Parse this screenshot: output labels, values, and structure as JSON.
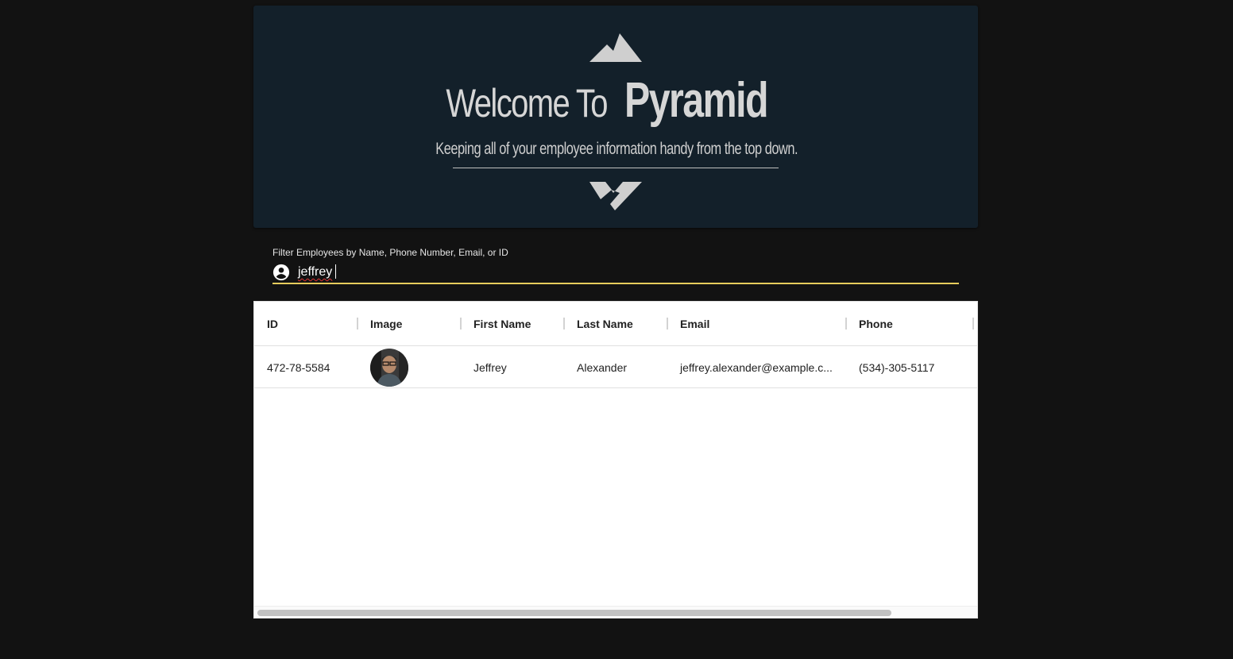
{
  "hero": {
    "welcome": "Welcome To",
    "brand": "Pyramid",
    "subtitle": "Keeping all of your employee information handy from the top down."
  },
  "filter": {
    "label": "Filter Employees by Name, Phone Number, Email, or ID",
    "value": "jeffrey",
    "icon": "account-circle-icon"
  },
  "table": {
    "columns": [
      "ID",
      "Image",
      "First Name",
      "Last Name",
      "Email",
      "Phone"
    ],
    "rows": [
      {
        "id": "472-78-5584",
        "image": "avatar",
        "first_name": "Jeffrey",
        "last_name": "Alexander",
        "email": "jeffrey.alexander@example.c...",
        "phone": "(534)-305-5117"
      }
    ]
  },
  "colors": {
    "background": "#121212",
    "hero": "#13202a",
    "accent": "#e6cc5c"
  }
}
